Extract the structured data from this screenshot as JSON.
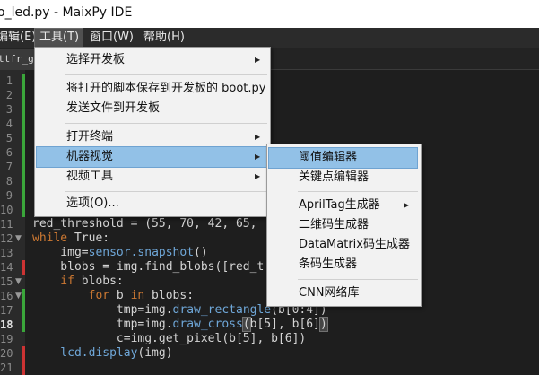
{
  "window": {
    "title": "o_led.py - MaixPy IDE"
  },
  "menubar": {
    "items": [
      {
        "label": "编辑(E)",
        "active": false
      },
      {
        "label": "工具(T)",
        "active": true
      },
      {
        "label": "窗口(W)",
        "active": false
      },
      {
        "label": "帮助(H)",
        "active": false
      }
    ]
  },
  "tabs": [
    {
      "label": "ttfr_gp"
    }
  ],
  "editor": {
    "line_numbers": [
      "1",
      "2",
      "3",
      "4",
      "5",
      "6",
      "7",
      "8",
      "9",
      "10",
      "11",
      "12",
      "13",
      "14",
      "15",
      "16",
      "17",
      "18",
      "19",
      "20",
      "21"
    ],
    "current_line": "18",
    "code_lines": {
      "l11": "red_threshold = (55, 70, 42, 65,",
      "l12_kw": "while",
      "l12_val": " True:",
      "l13_a": "    img=",
      "l13_fn": "sensor.snapshot",
      "l13_b": "()",
      "l14": "    blobs = img.find_blobs([red_t",
      "l15_kw": "    if",
      "l15_b": " blobs:",
      "l16_kw1": "        for",
      "l16_b": " b ",
      "l16_kw2": "in",
      "l16_c": " blobs:",
      "l17_a": "            tmp=img.",
      "l17_fn": "draw_rectangle",
      "l17_b": "(b[0:4])",
      "l18_a": "            tmp=img.",
      "l18_fn": "draw_cross",
      "l18_p1": "(",
      "l18_b": "b[5], b[6]",
      "l18_p2": ")",
      "l19": "            c=img.get_pixel(b[5], b[6])",
      "l20_fn": "    lcd.display",
      "l20_b": "(img)"
    }
  },
  "tools_menu": {
    "items": [
      {
        "label": "选择开发板",
        "submenu": true
      },
      {
        "label": "将打开的脚本保存到开发板的 boot.py",
        "submenu": false
      },
      {
        "label": "发送文件到开发板",
        "submenu": false
      },
      {
        "label": "打开终端",
        "submenu": true
      },
      {
        "label": "机器视觉",
        "submenu": true,
        "selected": true
      },
      {
        "label": "视频工具",
        "submenu": true
      },
      {
        "label": "选项(O)...",
        "submenu": false
      }
    ]
  },
  "vision_submenu": {
    "items": [
      {
        "label": "阈值编辑器",
        "selected": true
      },
      {
        "label": "关键点编辑器"
      },
      {
        "label": "AprilTag生成器",
        "submenu": true
      },
      {
        "label": "二维码生成器"
      },
      {
        "label": "DataMatrix码生成器"
      },
      {
        "label": "条码生成器"
      },
      {
        "label": "CNN网络库"
      }
    ]
  },
  "colors": {
    "selection": "#92c1e7",
    "keyword": "#cc7832",
    "function": "#6fa7d8",
    "marker_green": "#3aa63a",
    "marker_red": "#cc3333"
  },
  "icons": [
    "submenu-arrow-icon",
    "fold-arrow-icon"
  ]
}
